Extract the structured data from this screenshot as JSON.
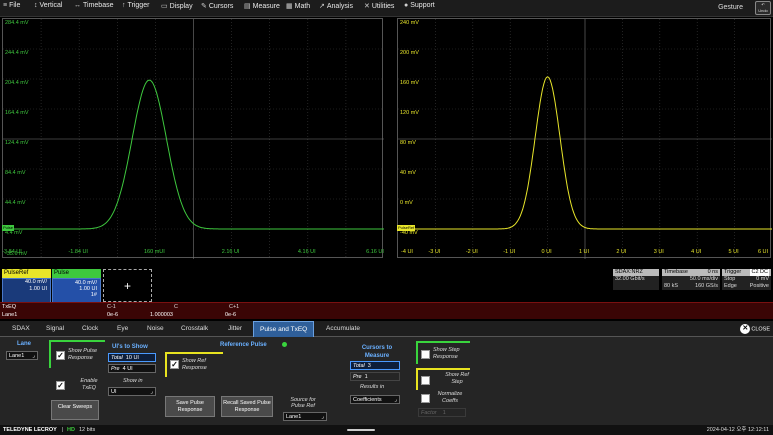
{
  "menu": [
    {
      "icon": "≡",
      "label": "File",
      "name": "menu-file"
    },
    {
      "icon": "↕",
      "label": "Vertical",
      "name": "menu-vertical"
    },
    {
      "icon": "↔",
      "label": "Timebase",
      "name": "menu-timebase"
    },
    {
      "icon": "↑",
      "label": "Trigger",
      "name": "menu-trigger"
    },
    {
      "icon": "▭",
      "label": "Display",
      "name": "menu-display"
    },
    {
      "icon": "✎",
      "label": "Cursors",
      "name": "menu-cursors"
    },
    {
      "icon": "▤",
      "label": "Measure",
      "name": "menu-measure"
    },
    {
      "icon": "▦",
      "label": "Math",
      "name": "menu-math"
    },
    {
      "icon": "↗",
      "label": "Analysis",
      "name": "menu-analysis"
    },
    {
      "icon": "✕",
      "label": "Utilities",
      "name": "menu-utilities"
    },
    {
      "icon": "●",
      "label": "Support",
      "name": "menu-support"
    }
  ],
  "gesture": "Gesture",
  "undo": "Undo",
  "left_grid": {
    "color": "#3ec83e",
    "y_labels": [
      "284.4 mV",
      "244.4 mV",
      "204.4 mV",
      "164.4 mV",
      "124.4 mV",
      "84.4 mV",
      "44.4 mV",
      "4.4 mV",
      "-35.6 mV"
    ],
    "x_labels": [
      "-3.84 UI",
      "-1.84 UI",
      "160 mUI",
      "2.16 UI",
      "4.16 UI",
      "6.16 UI"
    ],
    "marker": "Pulse"
  },
  "right_grid": {
    "color": "#e8e62a",
    "y_labels": [
      "240 mV",
      "200 mV",
      "160 mV",
      "120 mV",
      "80 mV",
      "40 mV",
      "0 mV",
      "-40 mV"
    ],
    "x_labels": [
      "-4 UI",
      "-3 UI",
      "-2 UI",
      "-1 UI",
      "0 UI",
      "1 UI",
      "2 UI",
      "3 UI",
      "4 UI",
      "5 UI",
      "6 UI"
    ],
    "marker": "PulseRef"
  },
  "pulse_left": {
    "peak": 203,
    "base": 4.4,
    "center_ui": 0.0,
    "sigma_ui": 0.45,
    "ymin": -35.6,
    "ymax": 284.4,
    "xmin": -3.84,
    "xmax": 6.16
  },
  "pulse_right": {
    "peak": 203,
    "base": 0,
    "center_ui": 0.0,
    "sigma_ui": 0.33,
    "ymin": -40,
    "ymax": 280,
    "xmin": -4,
    "xmax": 6
  },
  "traces": [
    {
      "name": "PulseRef",
      "line1": "40.0 mV/",
      "line2": "1.00 UI",
      "line3": "",
      "hdr_color": "#e8e62a"
    },
    {
      "name": "Pulse",
      "line1": "40.0 mV/",
      "line2": "1.00 UI",
      "line3": "1#",
      "hdr_color": "#3ec83e"
    }
  ],
  "add_trace": "+",
  "sdax": {
    "h": "SDAX:NRZ",
    "b": "32.00 Gbit/s"
  },
  "timebase": {
    "h1": "Timebase",
    "h2": "0 ns",
    "r1a": "",
    "r1b": "50.0 ms/div",
    "r2a": "80 kS",
    "r2b": "160 GS/s"
  },
  "trigger": {
    "h1": "Trigger",
    "h2": "C2 DC",
    "r1a": "Stop",
    "r1b": "0 mV",
    "r2a": "Edge",
    "r2b": "Positive"
  },
  "meas": {
    "row1_label": "TxEQ",
    "row2_label": "Lane1",
    "cols": [
      {
        "h": "C-1",
        "v": "0e-6"
      },
      {
        "h": "C",
        "v": "1.000003"
      },
      {
        "h": "C+1",
        "v": "0e-6"
      }
    ]
  },
  "tabs": [
    "SDAX",
    "Signal",
    "Clock",
    "Eye",
    "Noise",
    "Crosstalk",
    "Jitter",
    "Pulse and TxEQ",
    "Accumulate"
  ],
  "active_tab": "Pulse and TxEQ",
  "close": "CLOSE",
  "panel": {
    "lane_title": "Lane",
    "lane_value": "Lane1",
    "show_pulse_response": "Show Pulse Response",
    "enable_txeq": "Enable TxEQ",
    "clear_sweeps": "Clear Sweeps",
    "uis_title": "UI's to Show",
    "total_label": "Total",
    "total_value": "10 UI",
    "pre_label": "Pre",
    "pre_value": "4 UI",
    "show_in_label": "Show in",
    "show_in_value": "UI",
    "ref_title": "Reference Pulse",
    "show_ref_response": "Show Ref Response",
    "save_pulse": "Save Pulse Response",
    "recall_saved": "Recall Saved Pulse Response",
    "source_label": "Source for Pulse Ref",
    "source_value": "Lane1",
    "cursors_title": "Cursors to Measure",
    "c_total_label": "Total",
    "c_total_value": "3",
    "c_pre_label": "Pre",
    "c_pre_value": "1",
    "results_in": "Results in",
    "results_value": "Coefficients",
    "show_step": "Show Step Response",
    "show_ref_step": "Show Ref Step",
    "normalize": "Normalize Coeffs",
    "factor_label": "Factor",
    "factor_value": "1"
  },
  "status": {
    "brand": "TELEDYNE LECROY",
    "hd": "HD",
    "bits": "12 bits",
    "datetime": "2024-04-12 오후 12:12:11"
  }
}
